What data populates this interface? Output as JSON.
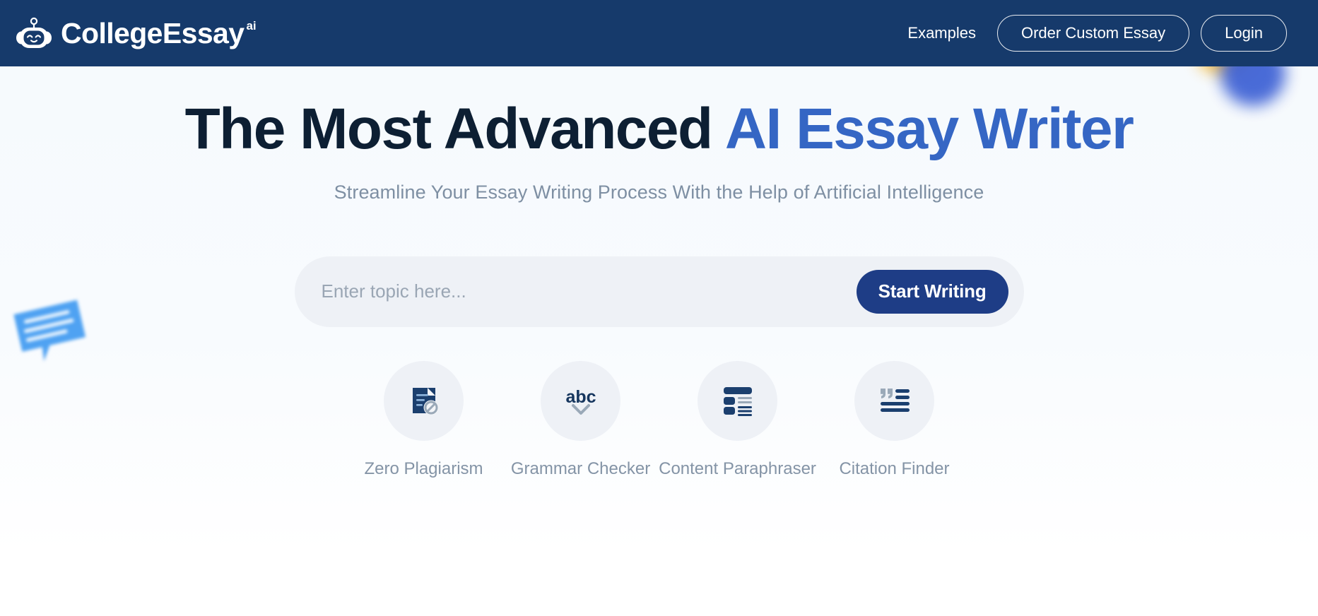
{
  "brand": {
    "name": "CollegeEssay",
    "suffix": "ai",
    "logo_icon": "robot-head-icon"
  },
  "nav": {
    "examples_label": "Examples",
    "order_label": "Order Custom Essay",
    "login_label": "Login",
    "background_color": "#163A6B"
  },
  "hero": {
    "headline_main": "The Most Advanced ",
    "headline_accent": "AI Essay Writer",
    "subhead": "Streamline Your Essay Writing Process With the Help of Artificial Intelligence",
    "accent_color": "#3566c4",
    "heading_color": "#0d1f33"
  },
  "search": {
    "placeholder": "Enter topic here...",
    "value": "",
    "button_label": "Start Writing",
    "button_color": "#1e3d86",
    "field_background": "#eef1f6"
  },
  "features": [
    {
      "label": "Zero Plagiarism",
      "icon": "document-blocked-icon"
    },
    {
      "label": "Grammar Checker",
      "icon": "abc-check-icon"
    },
    {
      "label": "Content Paraphraser",
      "icon": "layout-blocks-icon"
    },
    {
      "label": "Citation Finder",
      "icon": "quote-lines-icon"
    }
  ],
  "decorations": {
    "chat_bubble": "chat-bubble-decoration",
    "blob": "blue-yellow-blob-decoration"
  }
}
